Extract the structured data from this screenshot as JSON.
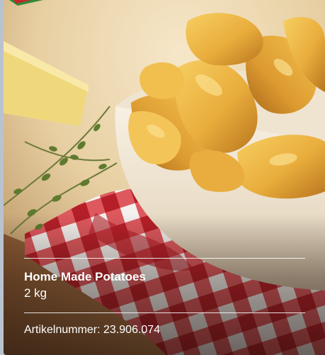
{
  "product": {
    "name": "Home Made Potatoes",
    "weight": "2 kg",
    "article_number": "Artikelnummer: 23.906.074"
  },
  "colors": {
    "text": "#ffffff",
    "page_background": "#b9c2cf",
    "cloth_red": "#d22a2f"
  },
  "icons": {
    "photo": "product-photo-potato-wedges"
  }
}
